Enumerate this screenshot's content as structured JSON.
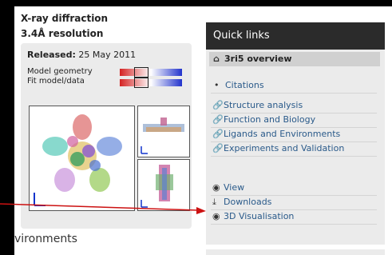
{
  "header": {
    "method": "X-ray diffraction",
    "resolution": "3.4Å resolution"
  },
  "summary": {
    "released_label": "Released:",
    "released_date": "25 May 2011",
    "model_geometry_label": "Model geometry",
    "fit_model_label": "Fit model/data",
    "model_geometry_percentile": 0.35,
    "fit_model_percentile": 0.35
  },
  "section_fragment": "vironments",
  "quick_links": {
    "title": "Quick links",
    "overview": "3ri5 overview",
    "citations": "Citations",
    "links": [
      "Structure analysis",
      "Function and Biology",
      "Ligands and Environments",
      "Experiments and Validation"
    ],
    "view": "View",
    "downloads": "Downloads",
    "visualisation": "3D Visualisation"
  },
  "colors": {
    "arrow": "#cc1111",
    "link": "#2a5a8a",
    "panel_dark": "#2b2b2b"
  }
}
